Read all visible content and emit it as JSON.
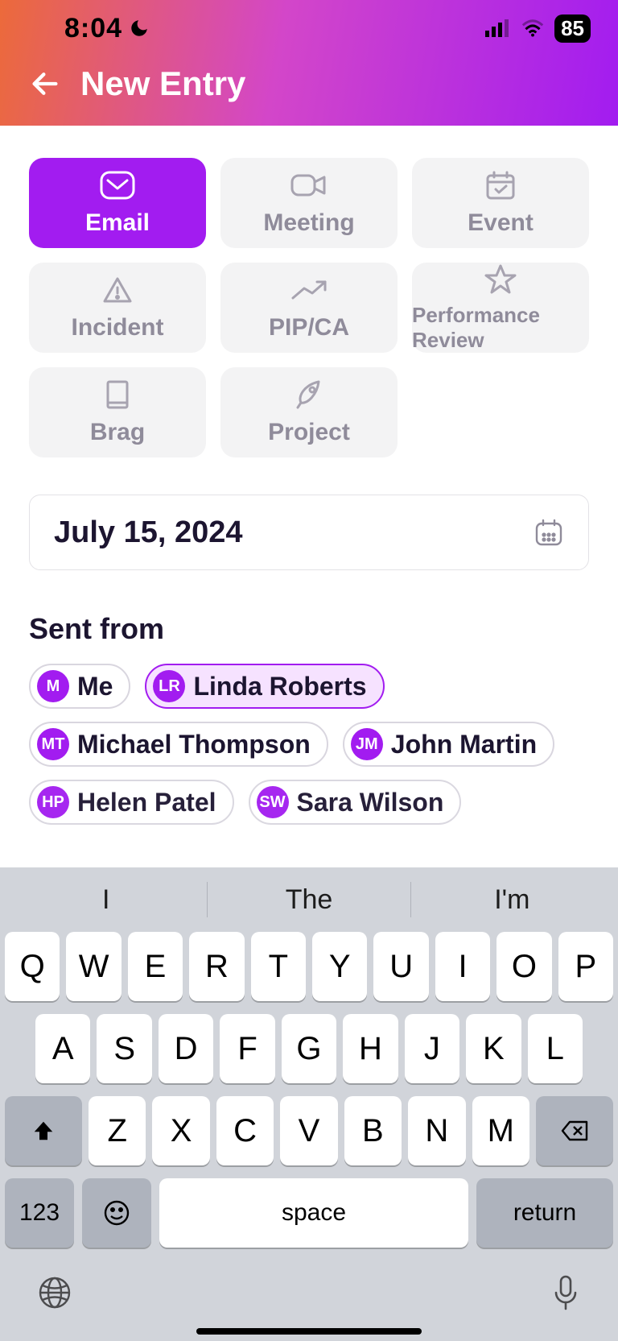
{
  "status": {
    "time": "8:04",
    "battery": "85"
  },
  "nav": {
    "title": "New Entry"
  },
  "types": [
    {
      "id": "email",
      "label": "Email",
      "icon": "mail",
      "active": true
    },
    {
      "id": "meeting",
      "label": "Meeting",
      "icon": "video",
      "active": false
    },
    {
      "id": "event",
      "label": "Event",
      "icon": "calendar-check",
      "active": false
    },
    {
      "id": "incident",
      "label": "Incident",
      "icon": "alert",
      "active": false
    },
    {
      "id": "pipca",
      "label": "PIP/CA",
      "icon": "trend",
      "active": false
    },
    {
      "id": "perf",
      "label": "Performance Review",
      "icon": "star",
      "active": false
    },
    {
      "id": "brag",
      "label": "Brag",
      "icon": "book",
      "active": false
    },
    {
      "id": "project",
      "label": "Project",
      "icon": "rocket",
      "active": false
    }
  ],
  "date": {
    "value": "July 15, 2024"
  },
  "sentFrom": {
    "label": "Sent from",
    "people": [
      {
        "initials": "M",
        "name": "Me",
        "selected": false
      },
      {
        "initials": "LR",
        "name": "Linda Roberts",
        "selected": true
      },
      {
        "initials": "MT",
        "name": "Michael Thompson",
        "selected": false
      },
      {
        "initials": "JM",
        "name": "John Martin",
        "selected": false
      },
      {
        "initials": "HP",
        "name": "Helen Patel",
        "selected": false
      },
      {
        "initials": "SW",
        "name": "Sara Wilson",
        "selected": false
      }
    ]
  },
  "keyboard": {
    "suggestions": [
      "I",
      "The",
      "I'm"
    ],
    "rows": [
      [
        "Q",
        "W",
        "E",
        "R",
        "T",
        "Y",
        "U",
        "I",
        "O",
        "P"
      ],
      [
        "A",
        "S",
        "D",
        "F",
        "G",
        "H",
        "J",
        "K",
        "L"
      ],
      [
        "Z",
        "X",
        "C",
        "V",
        "B",
        "N",
        "M"
      ]
    ],
    "numKey": "123",
    "spaceKey": "space",
    "returnKey": "return"
  }
}
